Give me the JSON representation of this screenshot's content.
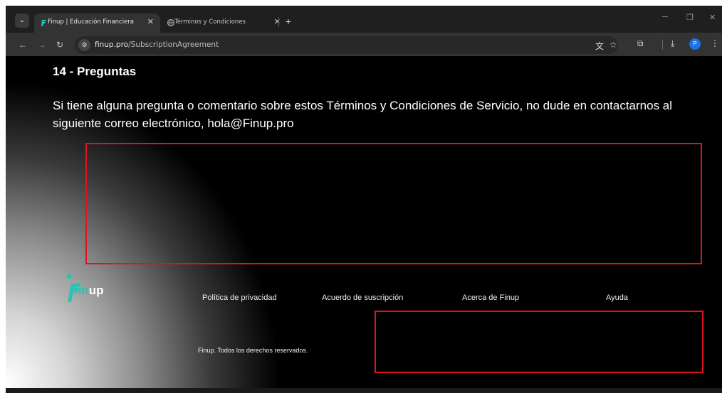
{
  "browser": {
    "tabs": [
      {
        "title": "Finup | Educación Financiera",
        "close": "✕",
        "active": true
      },
      {
        "title": "Términos y Condiciones",
        "close": "✕",
        "active": false
      }
    ],
    "new_tab_label": "+",
    "url_host": "finup.pro",
    "url_path": "/SubscriptionAgreement",
    "profile_initial": "P",
    "icons": {
      "tab_list": "chevron-down-icon",
      "back": "arrow-left-icon",
      "forward": "arrow-right-icon",
      "reload": "reload-icon",
      "site_info": "tune-icon",
      "translate": "translate-icon",
      "bookmark": "star-icon",
      "extensions": "puzzle-icon",
      "downloads": "download-icon",
      "menu": "more-vert-icon",
      "minimize": "minimize-icon",
      "restore": "restore-icon",
      "close": "close-icon"
    }
  },
  "page": {
    "heading": "14 - Preguntas",
    "paragraph": "Si tiene alguna pregunta o comentario sobre estos Términos y Condiciones de Servicio, no dude en contactarnos al siguiente correo electrónico, hola@Finup.pro",
    "logo": {
      "part1": "fin",
      "part2": "up"
    },
    "footer_links": [
      "Política de privacidad",
      "Acuerdo de suscripción",
      "Acerca de Finup",
      "Ayuda"
    ],
    "copyright": "Finup. Todos los derechos reservados."
  },
  "colors": {
    "brand_teal": "#29c4b5",
    "highlight_red": "#e0141e",
    "chrome_dark": "#1f1f1f",
    "profile_blue": "#1a73e8"
  }
}
